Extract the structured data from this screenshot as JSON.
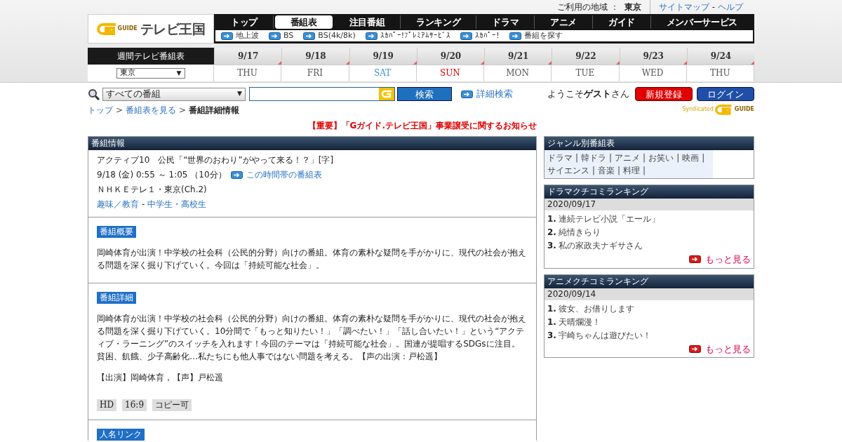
{
  "top_bar": {
    "region_label": "ご利用の地域 ：",
    "region": "東京",
    "links": [
      "サイトマップ",
      "ヘルプ"
    ],
    "link_separator": "-"
  },
  "logo": {
    "mark": "GUIDE",
    "name": "テレビ王国"
  },
  "nav": {
    "tabs": [
      {
        "label": "トップ",
        "selected": false
      },
      {
        "label": "番組表",
        "selected": true
      },
      {
        "label": "注目番組",
        "selected": false
      },
      {
        "label": "ランキング",
        "selected": false
      },
      {
        "label": "ドラマ",
        "selected": false
      },
      {
        "label": "アニメ",
        "selected": false
      },
      {
        "label": "ガイド",
        "selected": false
      },
      {
        "label": "メンバーサービス",
        "selected": false
      }
    ],
    "sub_links": [
      "地上波",
      "BS",
      "BS(4k/8k)",
      "ｽｶﾊﾟｰ!ﾌﾟﾚﾐｱﾑｻｰﾋﾞｽ",
      "ｽｶﾊﾟｰ!",
      "番組を探す"
    ]
  },
  "weekly": {
    "label": "週間テレビ番組表",
    "region_select": "東京",
    "dropdown_glyph": "▼",
    "days": [
      {
        "date": "9/17",
        "weekday": "THU",
        "kind": "weekday"
      },
      {
        "date": "9/18",
        "weekday": "FRI",
        "kind": "weekday"
      },
      {
        "date": "9/19",
        "weekday": "SAT",
        "kind": "saturday"
      },
      {
        "date": "9/20",
        "weekday": "SUN",
        "kind": "sunday"
      },
      {
        "date": "9/21",
        "weekday": "MON",
        "kind": "weekday"
      },
      {
        "date": "9/22",
        "weekday": "TUE",
        "kind": "weekday"
      },
      {
        "date": "9/23",
        "weekday": "WED",
        "kind": "weekday"
      },
      {
        "date": "9/24",
        "weekday": "THU",
        "kind": "weekday"
      }
    ]
  },
  "search": {
    "category": "すべての番組",
    "dropdown_glyph": "▼",
    "button": "検索",
    "advanced_link": "詳細検索"
  },
  "user": {
    "welcome": "ようこそ**ゲスト**さん",
    "register_button": "新規登録",
    "login_button": "ログイン",
    "syndicated": "Syndicated",
    "syndicated_mark": "GUIDE"
  },
  "breadcrumbs": {
    "separator": ">",
    "items": [
      {
        "text": "トップ",
        "link": true
      },
      {
        "text": "番組表を見る",
        "link": true
      },
      {
        "text": "番組詳細情報",
        "link": false
      }
    ]
  },
  "notice": "【重要】「Gガイド.テレビ王国」事業譲受に関するお知らせ",
  "program": {
    "header": "番組情報",
    "title": "アクティブ10　公民「“世界のおわり”がやって来る！？」[字]",
    "time": "9/18 (金) 0:55 ～ 1:05 （10分）",
    "time_link": "この時間帯の番組表",
    "channel": "ＮＨＫＥテレ１・東京(Ch.2)",
    "genre": [
      "趣味／教育",
      "中学生・高校生"
    ],
    "genre_separator": "-",
    "sections": [
      {
        "label": "番組概要",
        "paragraphs": [
          "岡崎体育が出演！中学校の社会科（公民的分野）向けの番組。体育の素朴な疑問を手がかりに、現代の社会が抱える問題を深く掘り下げていく。今回は「持続可能な社会」。"
        ]
      },
      {
        "label": "番組詳細",
        "paragraphs": [
          "岡崎体育が出演！中学校の社会科（公民的分野）向けの番組。体育の素朴な疑問を手がかりに、現代の社会が抱える問題を深く掘り下げていく。10分間で「もっと知りたい！」「調べたい！」「話し合いたい！」という“アクティブ・ラーニング”のスイッチを入れます！今回のテーマは「持続可能な社会」。国連が提唱するSDGsに注目。貧困、飢餓、少子高齢化…私たちにも他人事ではない問題を考える。【声の出演：戸松遥】",
          "【出演】岡崎体育，【声】戸松遥"
        ],
        "tags": [
          "HD",
          "16:9",
          "コピー可"
        ]
      },
      {
        "label": "人名リンク"
      }
    ]
  },
  "sidebar": {
    "genre_box": {
      "header": "ジャンル別番組表",
      "links": [
        "ドラマ",
        "韓ドラ",
        "アニメ",
        "お笑い",
        "映画",
        "サイエンス",
        "音楽",
        "料理"
      ],
      "separator": "|"
    },
    "rankings": [
      {
        "header": "ドラマクチコミランキング",
        "date": "2020/09/17",
        "items": [
          {
            "rank": "1.",
            "title": "連続テレビ小説「エール」"
          },
          {
            "rank": "2.",
            "title": "純情きらり"
          },
          {
            "rank": "3.",
            "title": "私の家政夫ナギサさん"
          }
        ],
        "more": "もっと見る"
      },
      {
        "header": "アニメクチコミランキング",
        "date": "2020/09/14",
        "items": [
          {
            "rank": "1.",
            "title": "彼女、お借りします"
          },
          {
            "rank": "1.",
            "title": "天晴爛漫！"
          },
          {
            "rank": "3.",
            "title": "宇崎ちゃんは遊びたい！"
          }
        ],
        "more": "もっと見る"
      }
    ]
  }
}
